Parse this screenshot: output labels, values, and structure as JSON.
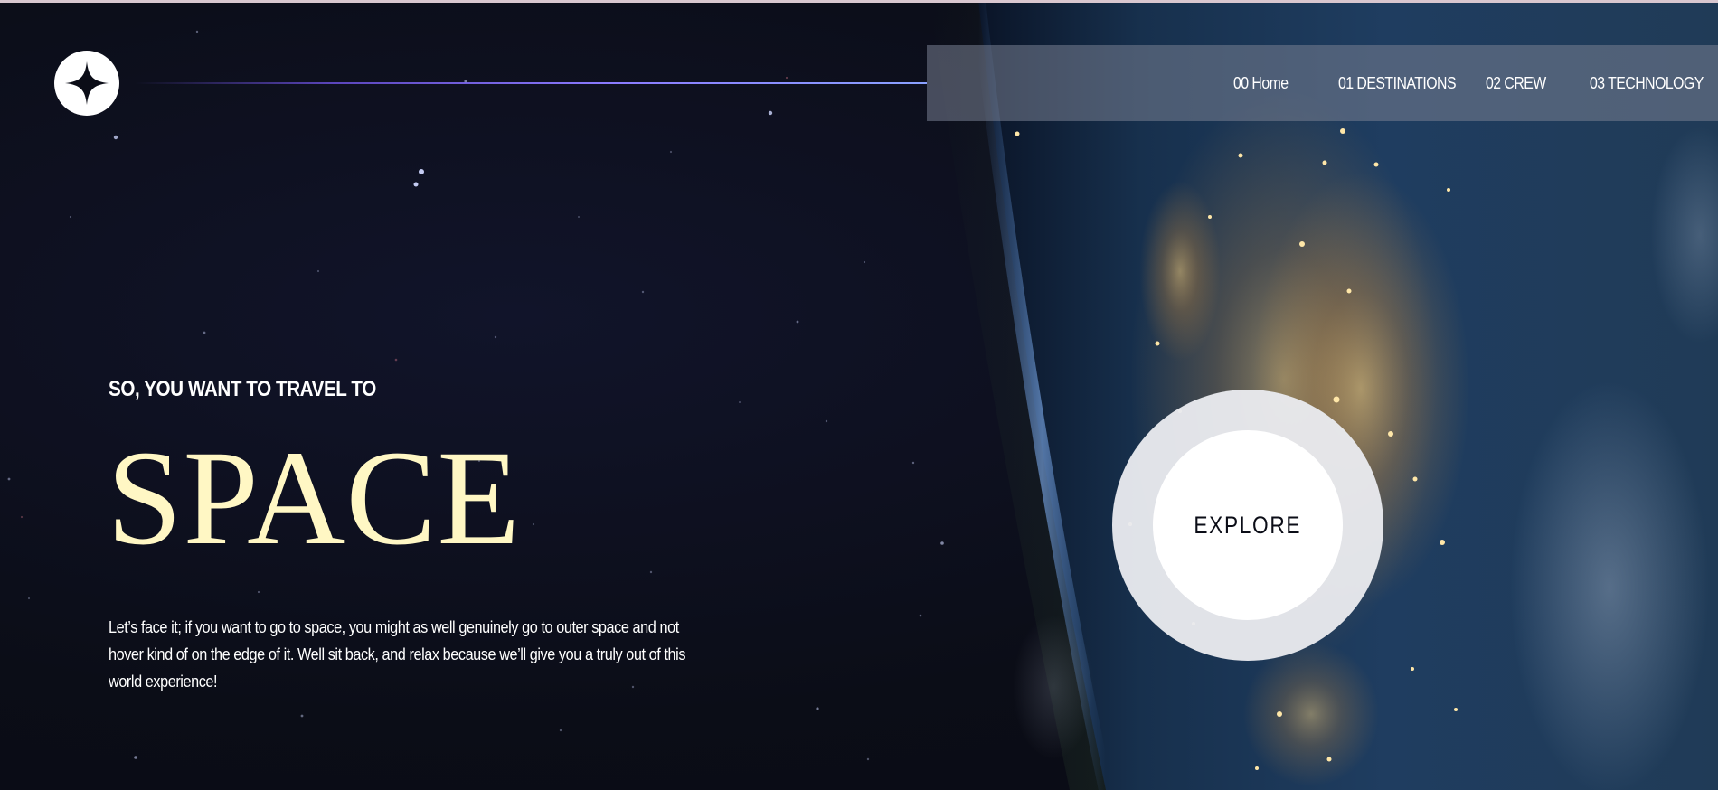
{
  "brand": {
    "logo_icon": "four-point-star-icon"
  },
  "nav": {
    "items": [
      {
        "label": "00 Home"
      },
      {
        "label": "01 DESTINATIONS"
      },
      {
        "label": "02 CREW"
      },
      {
        "label": "03 TECHNOLOGY"
      }
    ]
  },
  "hero": {
    "eyebrow": "SO, YOU WANT TO TRAVEL TO",
    "title": "SPACE",
    "description": "Let’s face it; if you want to go to space, you might as well genuinely go to outer space and not hover kind of on the edge of it. Well sit back, and relax because we’ll give you a truly out of this world experience!",
    "explore_label": "EXPLORE"
  },
  "colors": {
    "background": "#0b0d17",
    "accent_title": "#fff7c4",
    "navbar": "rgba(120,128,145,0.55)",
    "line_accent": "#8b7bff",
    "button": "#ffffff"
  }
}
